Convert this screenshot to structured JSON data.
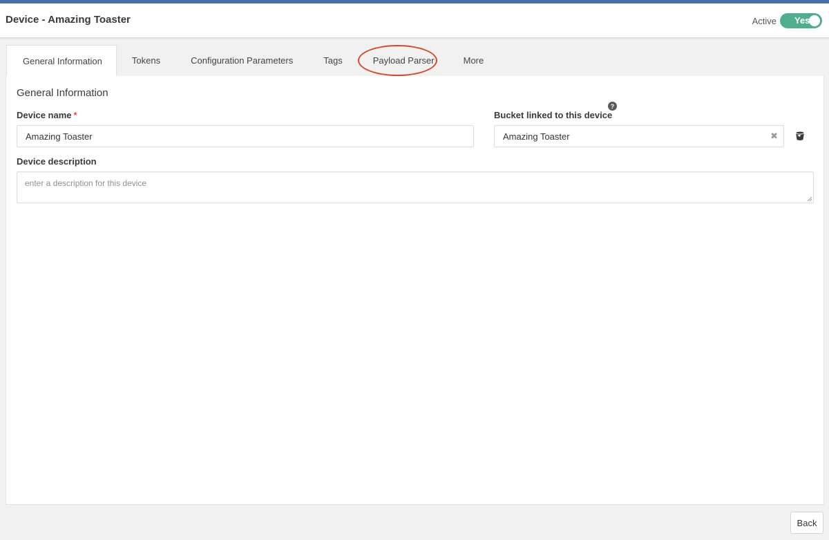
{
  "header": {
    "title": "Device - Amazing Toaster",
    "active_label": "Active",
    "active_toggle": "Yes"
  },
  "tabs": [
    {
      "label": "General Information",
      "active": true
    },
    {
      "label": "Tokens"
    },
    {
      "label": "Configuration Parameters"
    },
    {
      "label": "Tags"
    },
    {
      "label": "Payload Parser",
      "highlighted": true
    },
    {
      "label": "More"
    }
  ],
  "general": {
    "section_title": "General Information",
    "device_name_label": "Device name",
    "required_mark": "*",
    "device_name_value": "Amazing Toaster",
    "bucket_label": "Bucket linked to this device",
    "bucket_value": "Amazing Toaster",
    "help_glyph": "?",
    "clear_glyph": "✖",
    "description_label": "Device description",
    "description_placeholder": "enter a description for this device"
  },
  "footer": {
    "back_label": "Back"
  },
  "colors": {
    "accent_bar": "#4a6fa5",
    "toggle_on": "#4fae8e",
    "highlight_ring": "#d9472f",
    "required": "#d9534f"
  },
  "icons": {
    "help": "help-icon",
    "clear": "clear-icon",
    "bucket": "bucket-icon"
  }
}
